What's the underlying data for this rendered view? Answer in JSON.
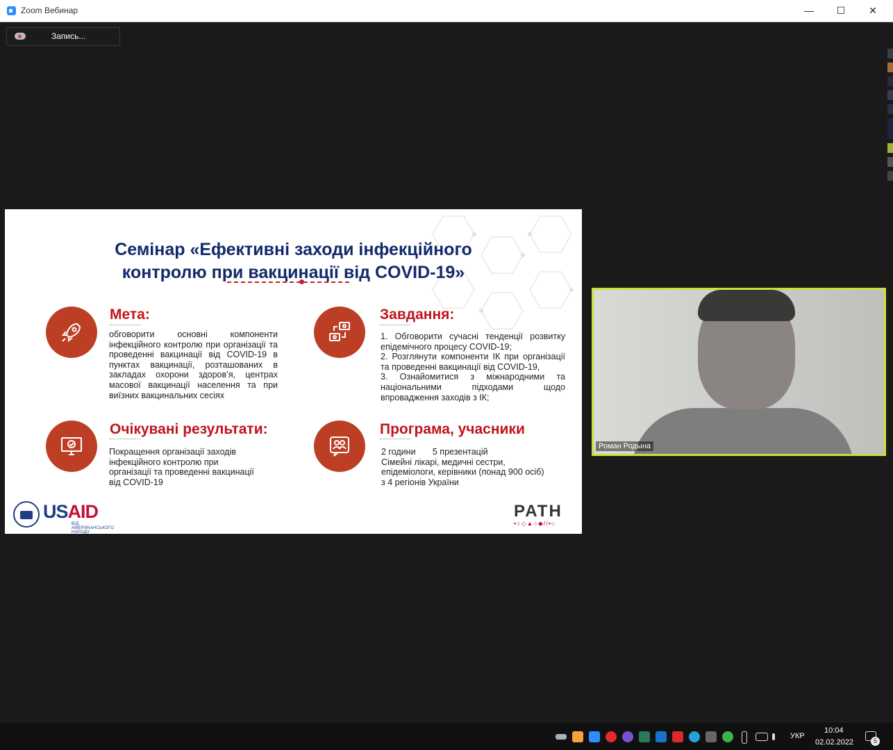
{
  "window": {
    "title": "Zoom Вебинар",
    "min": "—",
    "max": "☐",
    "close": "✕"
  },
  "recording": {
    "label": "Запись..."
  },
  "slide": {
    "title_line1": "Семінар «Ефективні заходи інфекційного",
    "title_line2": "контролю при вакцинації від COVID-19»",
    "goal": {
      "heading": "Мета:",
      "text": "обговорити основні компоненти інфекційного контролю при організації та проведенні вакцинації від COVID-19 в пунктах вакцинації, розташованих в закладах охорони здоров’я, центрах масової вакцинації населення та при виїзних вакцинальних сесіях"
    },
    "tasks": {
      "heading": "Завдання:",
      "items": [
        "1. Обговорити сучасні тенденції розвитку епідемічного процесу COVID-19;",
        "2. Розглянути компоненти ІК при організації та проведенні вакцинації від COVID-19,",
        "3. Ознайомитися з міжнародними та національними підходами щодо впровадження заходів з ІК;"
      ]
    },
    "results": {
      "heading": "Очікувані результати:",
      "text": "Покращення організації заходів інфекційного контролю при організації та проведенні вакцинації від COVID-19"
    },
    "program": {
      "heading": "Програма, учасники",
      "hours": "2 години",
      "presentations": "5 презентацій",
      "participants": "Сімейні лікарі, медичні сестри, епідеміологи, керівники (понад 900 осіб) з 4 регіонів України"
    },
    "usaid": {
      "us": "US",
      "aid": "AID",
      "tagline": "ВІД АМЕРИКАНСЬКОГО НАРОДУ"
    },
    "path": {
      "word": "PATH",
      "marks": "▪○◇▲○◆//▪○"
    }
  },
  "participant": {
    "name": "Роман Родына"
  },
  "taskbar": {
    "lang": "УКР",
    "time": "10:04",
    "date": "02.02.2022",
    "notif_count": "5"
  },
  "colors": {
    "accent_red": "#c0141c",
    "circle": "#bc3f25",
    "title_navy": "#13296b",
    "video_border": "#c6e23a"
  }
}
